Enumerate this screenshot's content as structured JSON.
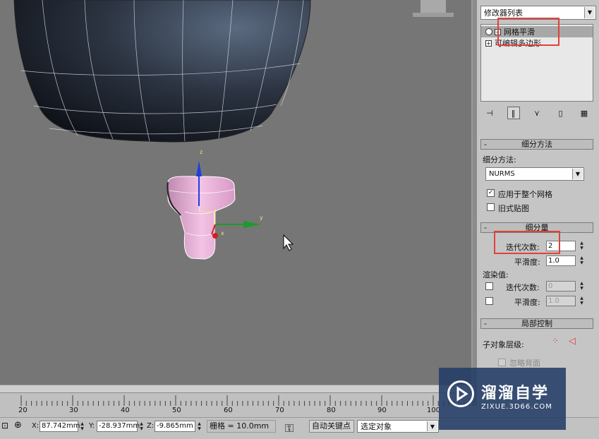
{
  "modifier_list": {
    "label": "修改器列表"
  },
  "stack": {
    "items": [
      {
        "label": "网格平滑",
        "selected": true
      },
      {
        "label": "可编辑多边形",
        "selected": false
      }
    ]
  },
  "subdivision_method": {
    "title": "细分方法",
    "method_label": "细分方法:",
    "method_value": "NURMS",
    "apply_whole_mesh": "应用于整个网格",
    "old_style_mapping": "旧式贴图"
  },
  "subdivision_amount": {
    "title": "细分量",
    "iterations_label": "迭代次数:",
    "iterations_value": "2",
    "smoothness_label": "平滑度:",
    "smoothness_value": "1.0",
    "render_values_label": "渲染值:",
    "render_iterations_label": "迭代次数:",
    "render_iterations_value": "0",
    "render_smoothness_label": "平滑度:",
    "render_smoothness_value": "1.0"
  },
  "local_control": {
    "title": "局部控制",
    "sub_object_level": "子对象层级:",
    "ignore_backfacing": "忽略背面"
  },
  "timeline": {
    "ticks": [
      "20",
      "30",
      "40",
      "50",
      "60",
      "70",
      "80",
      "90",
      "100"
    ]
  },
  "status": {
    "x_label": "X:",
    "x_value": "87.742mm",
    "y_label": "Y:",
    "y_value": "-28.937mm",
    "z_label": "Z:",
    "z_value": "-9.865mm",
    "grid": "栅格 = 10.0mm",
    "auto_key": "自动关键点",
    "selection_set": "选定对象"
  },
  "gizmo": {
    "x": "x",
    "y": "y",
    "z": "z"
  },
  "watermark": {
    "brand": "溜溜自学",
    "url": "ZIXUE.3D66.COM"
  },
  "colors": {
    "highlight_box": "#e0413b",
    "panel": "#c5c5c5",
    "viewport": "#767676"
  }
}
